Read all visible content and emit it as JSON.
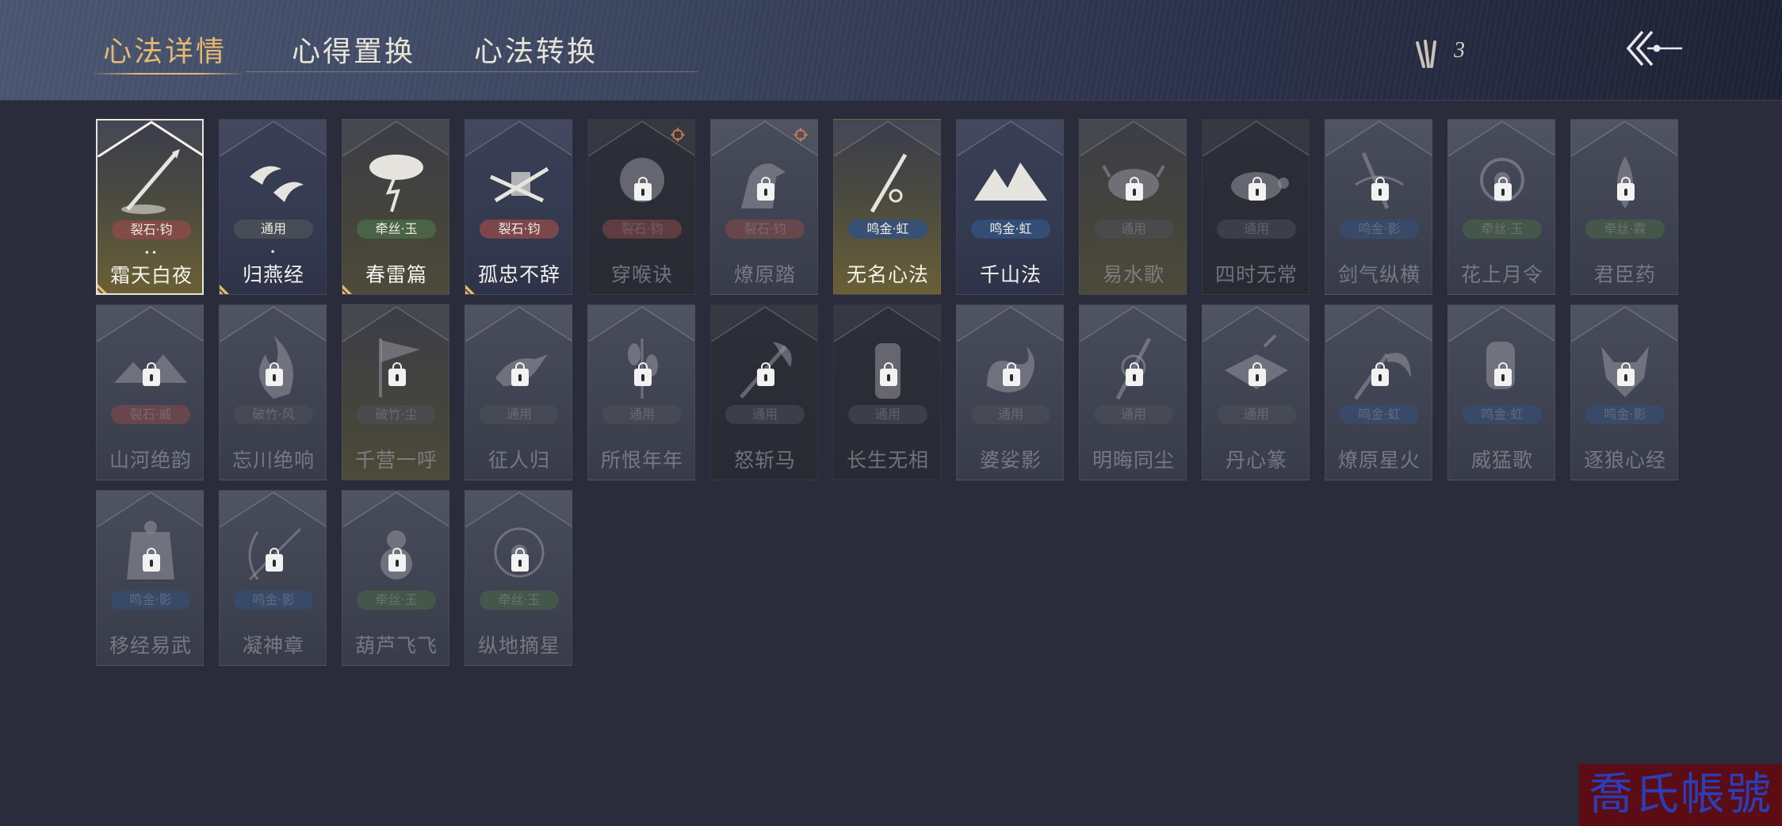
{
  "header": {
    "tabs": [
      {
        "label": "心法详情",
        "active": true
      },
      {
        "label": "心得置换",
        "active": false
      },
      {
        "label": "心法转换",
        "active": false
      }
    ],
    "currency_count": "3",
    "currency_icon": "tally-sticks-icon",
    "back_icon": "back-arrow-icon"
  },
  "colors": {
    "accent": "#e6b870",
    "badge_red": "#8a4a4a",
    "badge_blue": "#34507a",
    "badge_green": "#4b6848",
    "badge_gray": "#4c5058"
  },
  "cards": [
    {
      "name": "霜天白夜",
      "badge": "裂石·钧",
      "badge_type": "red",
      "unlocked": true,
      "selected": true,
      "bg": "gold",
      "dots": "••",
      "corner": true,
      "art": "spear"
    },
    {
      "name": "归燕经",
      "badge": "通用",
      "badge_type": "gray",
      "unlocked": true,
      "bg": "navy",
      "dots": "•",
      "corner": true,
      "art": "swallows"
    },
    {
      "name": "春雷篇",
      "badge": "牵丝·玉",
      "badge_type": "green",
      "unlocked": true,
      "bg": "olive",
      "corner": true,
      "art": "thunder"
    },
    {
      "name": "孤忠不辞",
      "badge": "裂石·钧",
      "badge_type": "red",
      "unlocked": true,
      "bg": "navy",
      "corner": true,
      "art": "blades"
    },
    {
      "name": "穿喉诀",
      "badge": "裂石·钧",
      "badge_type": "red",
      "unlocked": false,
      "bg": "dark",
      "target": true,
      "art": "mask"
    },
    {
      "name": "燎原踏",
      "badge": "裂石·钧",
      "badge_type": "red",
      "unlocked": false,
      "bg": "gray",
      "target": true,
      "art": "horse"
    },
    {
      "name": "无名心法",
      "badge": "鸣金·虹",
      "badge_type": "blue",
      "unlocked": true,
      "bg": "gold",
      "art": "sword"
    },
    {
      "name": "千山法",
      "badge": "鸣金·虹",
      "badge_type": "blue",
      "unlocked": true,
      "bg": "navy",
      "art": "mountains"
    },
    {
      "name": "易水歌",
      "badge": "通用",
      "badge_type": "gray",
      "unlocked": false,
      "bg": "olive",
      "art": "ox"
    },
    {
      "name": "四时无常",
      "badge": "通用",
      "badge_type": "gray",
      "unlocked": false,
      "bg": "dark",
      "art": "turtle"
    },
    {
      "name": "剑气纵横",
      "badge": "鸣金·影",
      "badge_type": "blue",
      "unlocked": false,
      "bg": "gray",
      "art": "swordwind"
    },
    {
      "name": "花上月令",
      "badge": "牵丝·玉",
      "badge_type": "green",
      "unlocked": false,
      "bg": "gray",
      "art": "flower"
    },
    {
      "name": "君臣药",
      "badge": "牵丝·霖",
      "badge_type": "green",
      "unlocked": false,
      "bg": "gray",
      "art": "herb"
    },
    {
      "name": "山河绝韵",
      "badge": "裂石·威",
      "badge_type": "red",
      "unlocked": false,
      "bg": "gray",
      "art": "hills"
    },
    {
      "name": "忘川绝响",
      "badge": "破竹·风",
      "badge_type": "gray",
      "unlocked": false,
      "bg": "gray",
      "art": "flame"
    },
    {
      "name": "千营一呼",
      "badge": "破竹·尘",
      "badge_type": "gray",
      "unlocked": false,
      "bg": "olive",
      "art": "flag"
    },
    {
      "name": "征人归",
      "badge": "通用",
      "badge_type": "gray",
      "unlocked": false,
      "bg": "gray",
      "art": "crow"
    },
    {
      "name": "所恨年年",
      "badge": "通用",
      "badge_type": "gray",
      "unlocked": false,
      "bg": "gray",
      "art": "reed"
    },
    {
      "name": "怒斩马",
      "badge": "通用",
      "badge_type": "gray",
      "unlocked": false,
      "bg": "dark",
      "art": "axe"
    },
    {
      "name": "长生无相",
      "badge": "通用",
      "badge_type": "gray",
      "unlocked": false,
      "bg": "dark",
      "art": "statue"
    },
    {
      "name": "婆娑影",
      "badge": "通用",
      "badge_type": "gray",
      "unlocked": false,
      "bg": "gray",
      "art": "dragon"
    },
    {
      "name": "明晦同尘",
      "badge": "通用",
      "badge_type": "gray",
      "unlocked": false,
      "bg": "gray",
      "art": "staff"
    },
    {
      "name": "丹心篆",
      "badge": "通用",
      "badge_type": "gray",
      "unlocked": false,
      "bg": "gray",
      "art": "scroll"
    },
    {
      "name": "燎原星火",
      "badge": "鸣金·虹",
      "badge_type": "blue",
      "unlocked": false,
      "bg": "gray",
      "art": "scythe"
    },
    {
      "name": "威猛歌",
      "badge": "鸣金·虹",
      "badge_type": "blue",
      "unlocked": false,
      "bg": "gray",
      "art": "fist"
    },
    {
      "name": "逐狼心经",
      "badge": "鸣金·影",
      "badge_type": "blue",
      "unlocked": false,
      "bg": "gray",
      "art": "wolf"
    },
    {
      "name": "移经易武",
      "badge": "鸣金·影",
      "badge_type": "blue",
      "unlocked": false,
      "bg": "gray",
      "art": "armor"
    },
    {
      "name": "凝神章",
      "badge": "鸣金·影",
      "badge_type": "blue",
      "unlocked": false,
      "bg": "gray",
      "art": "arrow"
    },
    {
      "name": "葫芦飞飞",
      "badge": "牵丝·玉",
      "badge_type": "green",
      "unlocked": false,
      "bg": "gray",
      "art": "gourd"
    },
    {
      "name": "纵地摘星",
      "badge": "牵丝·玉",
      "badge_type": "green",
      "unlocked": false,
      "bg": "gray",
      "art": "orbit"
    }
  ],
  "watermark": "喬氏帳號"
}
